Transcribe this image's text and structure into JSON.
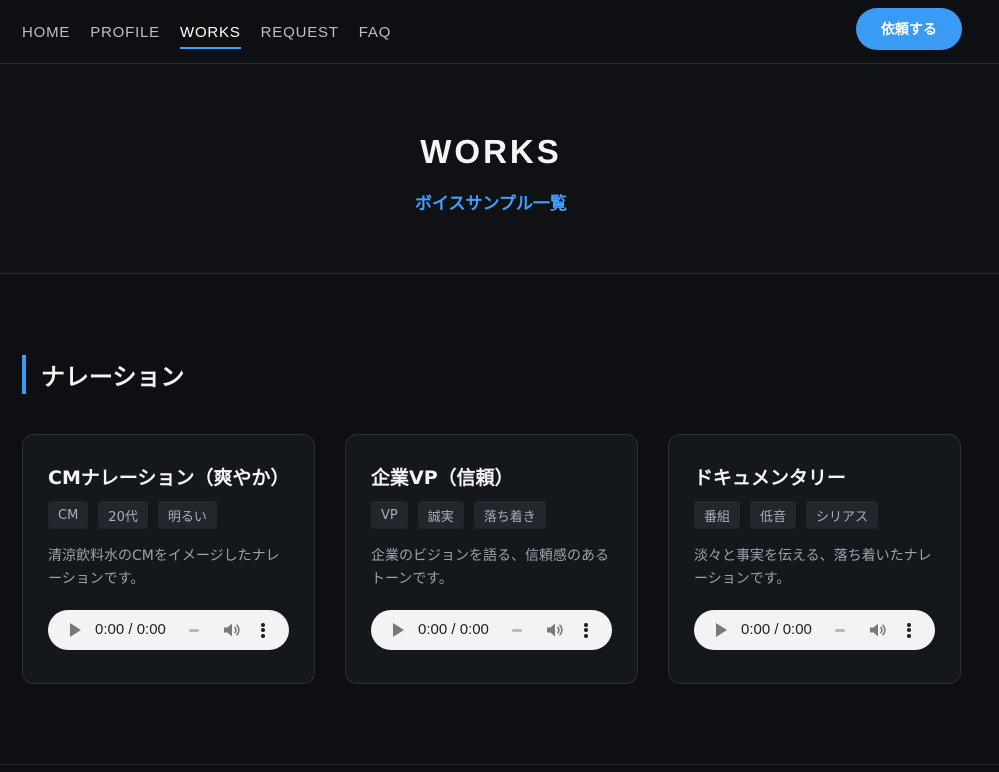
{
  "nav": {
    "links": [
      {
        "label": "HOME"
      },
      {
        "label": "PROFILE"
      },
      {
        "label": "WORKS"
      },
      {
        "label": "REQUEST"
      },
      {
        "label": "FAQ"
      }
    ],
    "active": "WORKS",
    "cta_label": "依頼する"
  },
  "hero": {
    "title": "WORKS",
    "subtitle": "ボイスサンプル一覧"
  },
  "section": {
    "heading": "ナレーション",
    "cards": [
      {
        "title": "CMナレーション（爽やか）",
        "tags": [
          "CM",
          "20代",
          "明るい"
        ],
        "description": "清涼飲料水のCMをイメージしたナレーションです。",
        "player_time": "0:00 / 0:00"
      },
      {
        "title": "企業VP（信頼）",
        "tags": [
          "VP",
          "誠実",
          "落ち着き"
        ],
        "description": "企業のビジョンを語る、信頼感のあるトーンです。",
        "player_time": "0:00 / 0:00"
      },
      {
        "title": "ドキュメンタリー",
        "tags": [
          "番組",
          "低音",
          "シリアス"
        ],
        "description": "淡々と事実を伝える、落ち着いたナレーションです。",
        "player_time": "0:00 / 0:00"
      }
    ]
  },
  "colors": {
    "background": "#0d0f12",
    "accent": "#3a9bf4",
    "card": "#14171c",
    "tag": "#22262d"
  },
  "icons": {
    "play": "play-icon",
    "volume": "volume-icon",
    "more": "more-vertical-icon"
  }
}
